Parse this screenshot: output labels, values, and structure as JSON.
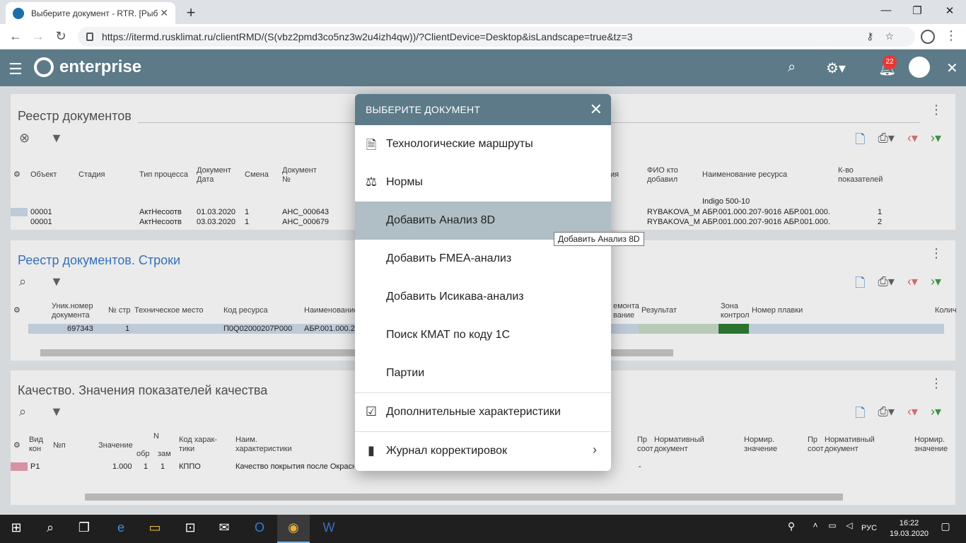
{
  "browser": {
    "tab_title": "Выберите документ - RTR. [Рыб",
    "url": "https://itermd.rusklimat.ru/clientRMD/(S(vbz2pmd3co5nz3w2u4izh4qw))/?ClientDevice=Desktop&isLandscape=true&tz=3"
  },
  "app": {
    "logo_text": "enterprise",
    "notif_count": "22"
  },
  "panel1": {
    "title": "Реестр документов",
    "headers": [
      "Объект",
      "Стадия",
      "Тип процесса",
      "Документ Дата",
      "Смена",
      "Документ №",
      "ФИО кто добавил",
      "Наименование ресурса",
      "К-во показателей"
    ],
    "extra_row": "Indigo 500-10",
    "rows": [
      {
        "obj": "00001",
        "type": "АктНесоотв",
        "date": "01.03.2020",
        "shift": "1",
        "num": "АНС_000643",
        "fio": "RYBAKOVA_M",
        "res": "АБР.001.000.207-9016 АБР.001.000.",
        "cnt": "1"
      },
      {
        "obj": "00001",
        "type": "АктНесоотв",
        "date": "03.03.2020",
        "shift": "1",
        "num": "АНС_000679",
        "fio": "RYBAKOVA_M",
        "res": "АБР.001.000.207-9016 АБР.001.000.",
        "cnt": "2"
      }
    ],
    "partial_header": "ия"
  },
  "panel2": {
    "title": "Реестр документов. Строки",
    "headers": [
      "Уник.номер документа",
      "№ стр",
      "Техническое место",
      "Код ресурса",
      "Наименование",
      "емонта вание",
      "Результат",
      "Зона контрол",
      "Номер плавки",
      "Колич"
    ],
    "row": {
      "uid": "697343",
      "line": "1",
      "code": "П0Q02000207Р000",
      "name": "АБР.001.000.2"
    }
  },
  "panel3": {
    "title": "Качество. Значения показателей качества",
    "headers": [
      "Вид кон",
      "№п",
      "Значение",
      "N",
      "обр",
      "зам",
      "Код харак-тики",
      "Наим. характеристики",
      "Пр соот",
      "Нормативный документ",
      "Нормир. значение",
      "Пр соот",
      "Нормативный документ",
      "Нормир. значение"
    ],
    "row": {
      "kind": "Р1",
      "value": "1.000",
      "n1": "1",
      "n2": "1",
      "code": "КППО",
      "name": "Качество покрытия после Окрасн",
      "dash": "-"
    }
  },
  "dialog": {
    "title": "ВЫБЕРИТЕ ДОКУМЕНТ",
    "items": [
      {
        "label": "Технологические маршруты",
        "icon": "document-icon"
      },
      {
        "label": "Нормы",
        "icon": "scales-icon"
      },
      {
        "label": "Добавить Анализ 8D",
        "icon": ""
      },
      {
        "label": "Добавить FMEA-анализ",
        "icon": ""
      },
      {
        "label": "Добавить Исикава-анализ",
        "icon": ""
      },
      {
        "label": "Поиск КМАТ по коду 1С",
        "icon": ""
      },
      {
        "label": "Партии",
        "icon": ""
      },
      {
        "label": "Дополнительные характеристики",
        "icon": "checkbox-icon"
      },
      {
        "label": "Журнал корректировок",
        "icon": "journal-icon"
      }
    ],
    "highlighted_item": "Добавить Анализ 8D"
  },
  "tooltip": "Добавить Анализ 8D",
  "taskbar": {
    "lang": "РУС",
    "time": "16:22",
    "date": "19.03.2020"
  },
  "colors": {
    "appbar": "#5c7a88",
    "accent_blue": "#3b7bc9",
    "highlight": "#b0bec5",
    "badge": "#e53935"
  }
}
